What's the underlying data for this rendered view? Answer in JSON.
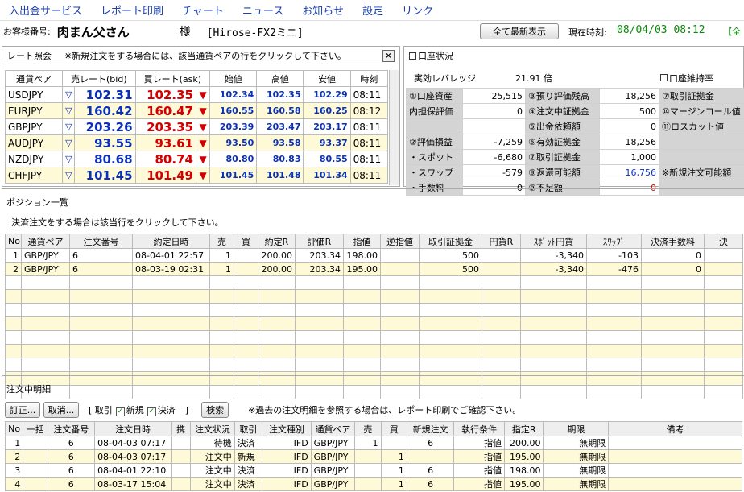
{
  "menu": [
    "入出金サービス",
    "レポート印刷",
    "チャート",
    "ニュース",
    "お知らせ",
    "設定",
    "リンク"
  ],
  "top": {
    "customer_label": "お客様番号:",
    "customer_name": "肉まん父さん",
    "honorific": "様",
    "account": "[Hirose-FX2ミニ]",
    "refresh": "全て最新表示",
    "time_label": "現在時刻:",
    "time": "08/04/03 08:12",
    "cut": "【全"
  },
  "rate": {
    "title": "レート照会",
    "note": "※新規注文をする場合には、該当通貨ペアの行をクリックして下さい。",
    "close": "×",
    "headers": [
      "通貨ペア",
      "売レート(bid)",
      "買レート(ask)",
      "始値",
      "高値",
      "安値",
      "時刻"
    ],
    "rows": [
      [
        "USDJPY",
        "102.31",
        "102.35",
        "102.34",
        "102.35",
        "102.29",
        "08:11"
      ],
      [
        "EURJPY",
        "160.42",
        "160.47",
        "160.55",
        "160.58",
        "160.25",
        "08:12"
      ],
      [
        "GBPJPY",
        "203.26",
        "203.35",
        "203.39",
        "203.47",
        "203.17",
        "08:11"
      ],
      [
        "AUDJPY",
        "93.55",
        "93.61",
        "93.50",
        "93.58",
        "93.37",
        "08:11"
      ],
      [
        "NZDJPY",
        "80.68",
        "80.74",
        "80.80",
        "80.83",
        "80.55",
        "08:11"
      ],
      [
        "CHFJPY",
        "101.45",
        "101.49",
        "101.45",
        "101.48",
        "101.34",
        "08:11"
      ]
    ]
  },
  "account": {
    "title": "口座状況",
    "lev_label": "実効レバレッジ",
    "lev": "21.91 倍",
    "margin_label": "口座維持率",
    "rows": [
      [
        "①口座資産",
        "25,515",
        "③預り評価残高",
        "18,256",
        "⑦取引証拠金"
      ],
      [
        "内担保評価",
        "0",
        "④注文中証拠金",
        "500",
        "⑩マージンコール値"
      ],
      [
        "",
        "",
        "⑤出金依頼額",
        "0",
        "⑪ロスカット値"
      ],
      [
        "②評価損益",
        "-7,259",
        "⑥有効証拠金",
        "18,256",
        ""
      ],
      [
        "・スポット",
        "-6,680",
        "⑦取引証拠金",
        "1,000",
        ""
      ],
      [
        "・スワップ",
        "-579",
        "⑧返還可能額",
        "16,756",
        "※新規注文可能額"
      ],
      [
        "・手数料",
        "0",
        "⑨不足額",
        "0",
        ""
      ]
    ]
  },
  "positions": {
    "title": "ポジション一覧",
    "note": "決済注文をする場合は該当行をクリックして下さい。",
    "headers": [
      "No",
      "通貨ペア",
      "注文番号",
      "約定日時",
      "売",
      "買",
      "約定R",
      "評価R",
      "指値",
      "逆指値",
      "取引証拠金",
      "円貨R",
      "ｽﾎﾟｯﾄ円貨",
      "ｽﾜｯﾌﾟ",
      "決済手数料",
      "決"
    ],
    "rows": [
      [
        "1",
        "GBP/JPY",
        "6",
        "08-04-01 22:57",
        "1",
        "",
        "200.00",
        "203.34",
        "198.00",
        "",
        "500",
        "",
        "-3,340",
        "-103",
        "0"
      ],
      [
        "2",
        "GBP/JPY",
        "6",
        "08-03-19 02:31",
        "1",
        "",
        "200.00",
        "203.34",
        "195.00",
        "",
        "500",
        "",
        "-3,340",
        "-476",
        "0"
      ]
    ]
  },
  "orders": {
    "title": "注文中明細",
    "btn_edit": "訂正...",
    "btn_cancel": "取消...",
    "filter_open": "[ 取引",
    "filter_new": "新規",
    "filter_settle": "決済",
    "filter_close": "]",
    "search": "検索",
    "note": "※過去の注文明細を参照する場合は、レポート印刷でご確認下さい。",
    "headers": [
      "No",
      "一括",
      "注文番号",
      "注文日時",
      "携",
      "注文状況",
      "取引",
      "注文種別",
      "通貨ペア",
      "売",
      "買",
      "新規注文",
      "執行条件",
      "指定R",
      "期限",
      "備考"
    ],
    "rows": [
      [
        "1",
        "",
        "6",
        "08-04-03 07:17",
        "",
        "待機",
        "決済",
        "IFD",
        "GBP/JPY",
        "1",
        "",
        "6",
        "指値",
        "200.00",
        "無期限",
        ""
      ],
      [
        "2",
        "",
        "6",
        "08-04-03 07:17",
        "",
        "注文中",
        "新規",
        "IFD",
        "GBP/JPY",
        "",
        "1",
        "",
        "指値",
        "195.00",
        "無期限",
        ""
      ],
      [
        "3",
        "",
        "6",
        "08-04-01 22:10",
        "",
        "注文中",
        "決済",
        "IFD",
        "GBP/JPY",
        "",
        "1",
        "6",
        "指値",
        "198.00",
        "無期限",
        ""
      ],
      [
        "4",
        "",
        "6",
        "08-03-17 15:04",
        "",
        "注文中",
        "決済",
        "IFD",
        "GBP/JPY",
        "",
        "1",
        "6",
        "指値",
        "195.00",
        "無期限",
        ""
      ]
    ]
  }
}
